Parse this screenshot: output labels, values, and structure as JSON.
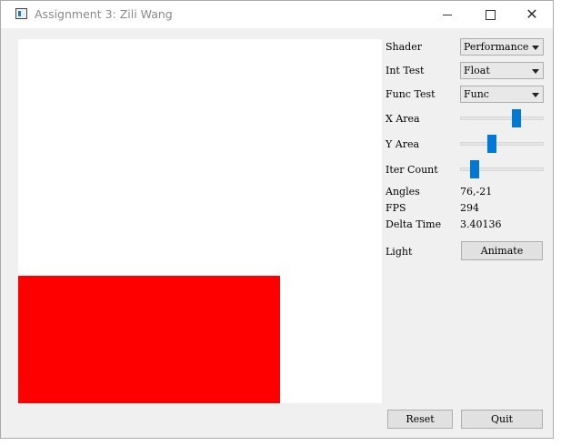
{
  "window": {
    "title": "Assignment 3: Zili Wang",
    "close_glyph": "✕"
  },
  "controls": {
    "shader": {
      "label": "Shader",
      "value": "Performance"
    },
    "int_test": {
      "label": "Int Test",
      "value": "Float"
    },
    "func_test": {
      "label": "Func Test",
      "value": "Func"
    },
    "x_area": {
      "label": "X Area",
      "level": 0.7
    },
    "y_area": {
      "label": "Y Area",
      "level": 0.36
    },
    "iter_count": {
      "label": "Iter Count",
      "level": 0.13
    }
  },
  "stats": {
    "angles": {
      "label": "Angles",
      "value": "76,-21"
    },
    "fps": {
      "label": "FPS",
      "value": "294"
    },
    "delta_time": {
      "label": "Delta Time",
      "value": "3.40136"
    }
  },
  "light": {
    "label": "Light",
    "button": "Animate"
  },
  "footer": {
    "reset": "Reset",
    "quit": "Quit"
  },
  "colors": {
    "accent": "#0078d7",
    "render_fill": "#ff0000"
  }
}
